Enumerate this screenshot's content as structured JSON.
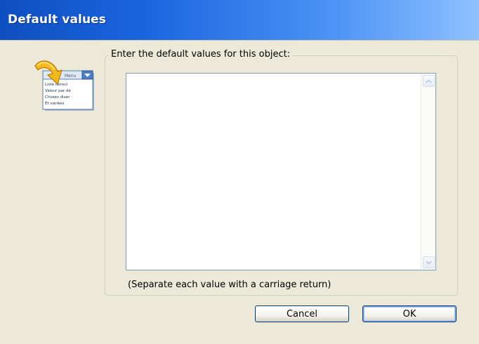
{
  "window": {
    "title": "Default values"
  },
  "dialog": {
    "group_label": "Enter the default values for this object:",
    "textarea_value": "",
    "hint": "(Separate each value with a carriage return)",
    "icon": "dropdown-list-icon",
    "icon_text": {
      "header": "Menu",
      "items": [
        "Liste déroul",
        "Valeur par dé",
        "Choses diver",
        "Et variées"
      ]
    }
  },
  "buttons": {
    "cancel_label": "Cancel",
    "ok_label": "OK"
  },
  "colors": {
    "titlebar_start": "#0e4fc0",
    "titlebar_end": "#8fc1ff",
    "client_bg": "#ece9d8",
    "button_border": "#003c74"
  }
}
